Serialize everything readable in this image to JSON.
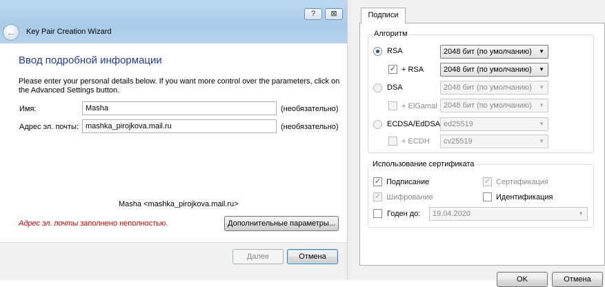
{
  "wizard": {
    "title": "Key Pair Creation Wizard",
    "help_glyph": "?",
    "close_glyph": "⊠",
    "back_glyph": "←",
    "heading": "Ввод подробной информации",
    "intro_line1": "Please enter your personal details below. If you want more control over the parameters, click on",
    "intro_line2": "the Advanced Settings button.",
    "name_label": "Имя:",
    "name_value": "Masha",
    "name_optional": "(необязательно)",
    "email_label": "Адрес эл. почты:",
    "email_value": "mashka_pirojkova.mail.ru",
    "email_optional": "(необязательно)",
    "user_id_preview": "Masha <mashka_pirojkova.mail.ru>",
    "error_field": "Адрес эл. почты",
    "error_rest": " заполнено неполностью.",
    "advanced_button": "Дополнительные параметры...",
    "next_button": "Далее",
    "cancel_button": "Отмена"
  },
  "dialog": {
    "tab_label": "Подписи",
    "algo_legend": "Алгоритм",
    "rsa_label": "RSA",
    "rsa_size": "2048 бит (по умолчанию)",
    "rsa_sub_label": "+ RSA",
    "rsa_sub_size": "2048 бит (по умолчанию)",
    "dsa_label": "DSA",
    "dsa_size": "2048 бит (по умолчанию)",
    "elgamal_label": "+ ElGamal",
    "elgamal_size": "2048 бит (по умолчанию)",
    "ecdsa_label": "ECDSA/EdDSA",
    "ecdsa_curve": "ed25519",
    "ecdh_label": "+ ECDH",
    "ecdh_curve": "cv25519",
    "usage_legend": "Использование сертификата",
    "sign_label": "Подписание",
    "cert_label": "Сертификация",
    "encrypt_label": "Шифрование",
    "auth_label": "Идентификация",
    "valid_until_label": "Годен до:",
    "valid_until_value": "19.04.2020",
    "check_glyph": "✓",
    "arrow_glyph": "▼",
    "ok_button": "OK",
    "cancel_button": "Отмена"
  },
  "icons": {
    "back": "back-arrow-icon",
    "dropdown": "chevron-down-icon"
  },
  "colors": {
    "heading": "#1f3e96",
    "error": "#cc0000",
    "titlebar": "#a9cbe8"
  }
}
